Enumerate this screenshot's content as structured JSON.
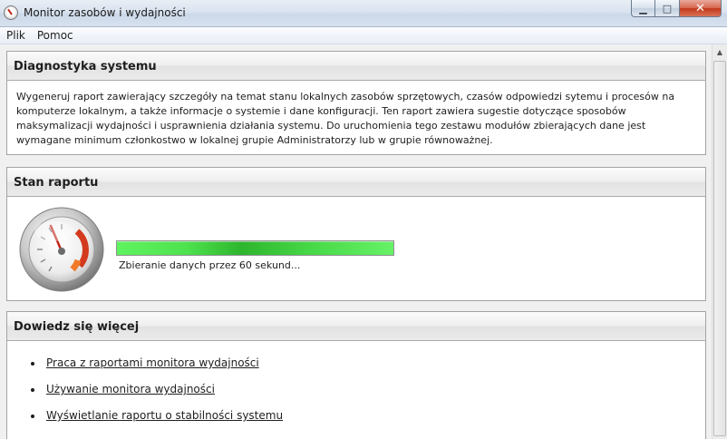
{
  "window": {
    "title": "Monitor zasobów i wydajności",
    "buttons": {
      "minimize": "▁",
      "maximize": "□",
      "close": "✕"
    }
  },
  "menu": [
    "Plik",
    "Pomoc"
  ],
  "diagnostics": {
    "heading": "Diagnostyka systemu",
    "description": "Wygeneruj raport zawierający szczegóły na temat stanu lokalnych zasobów sprzętowych, czasów odpowiedzi sytemu i procesów na komputerze lokalnym, a także informacje o systemie i dane konfiguracji. Ten raport zawiera sugestie dotyczące sposobów maksymalizacji wydajności i usprawnienia działania systemu. Do uruchomienia tego zestawu modułów zbierających dane jest wymagane minimum członkostwo w lokalnej grupie Administratorzy lub w grupie równoważnej."
  },
  "report_status": {
    "heading": "Stan raportu",
    "progress": 1.0,
    "status_text": "Zbieranie danych przez 60 sekund..."
  },
  "learn_more": {
    "heading": "Dowiedz się więcej",
    "links": [
      "Praca z raportami monitora wydajności",
      "Używanie monitora wydajności",
      "Wyświetlanie raportu o stabilności systemu"
    ]
  },
  "colors": {
    "progress_green": "#4ee24e",
    "close_red": "#c2391b",
    "gauge_needle": "#c2261d"
  },
  "icons": {
    "app": "gauge-icon",
    "report": "performance-gauge-icon"
  }
}
